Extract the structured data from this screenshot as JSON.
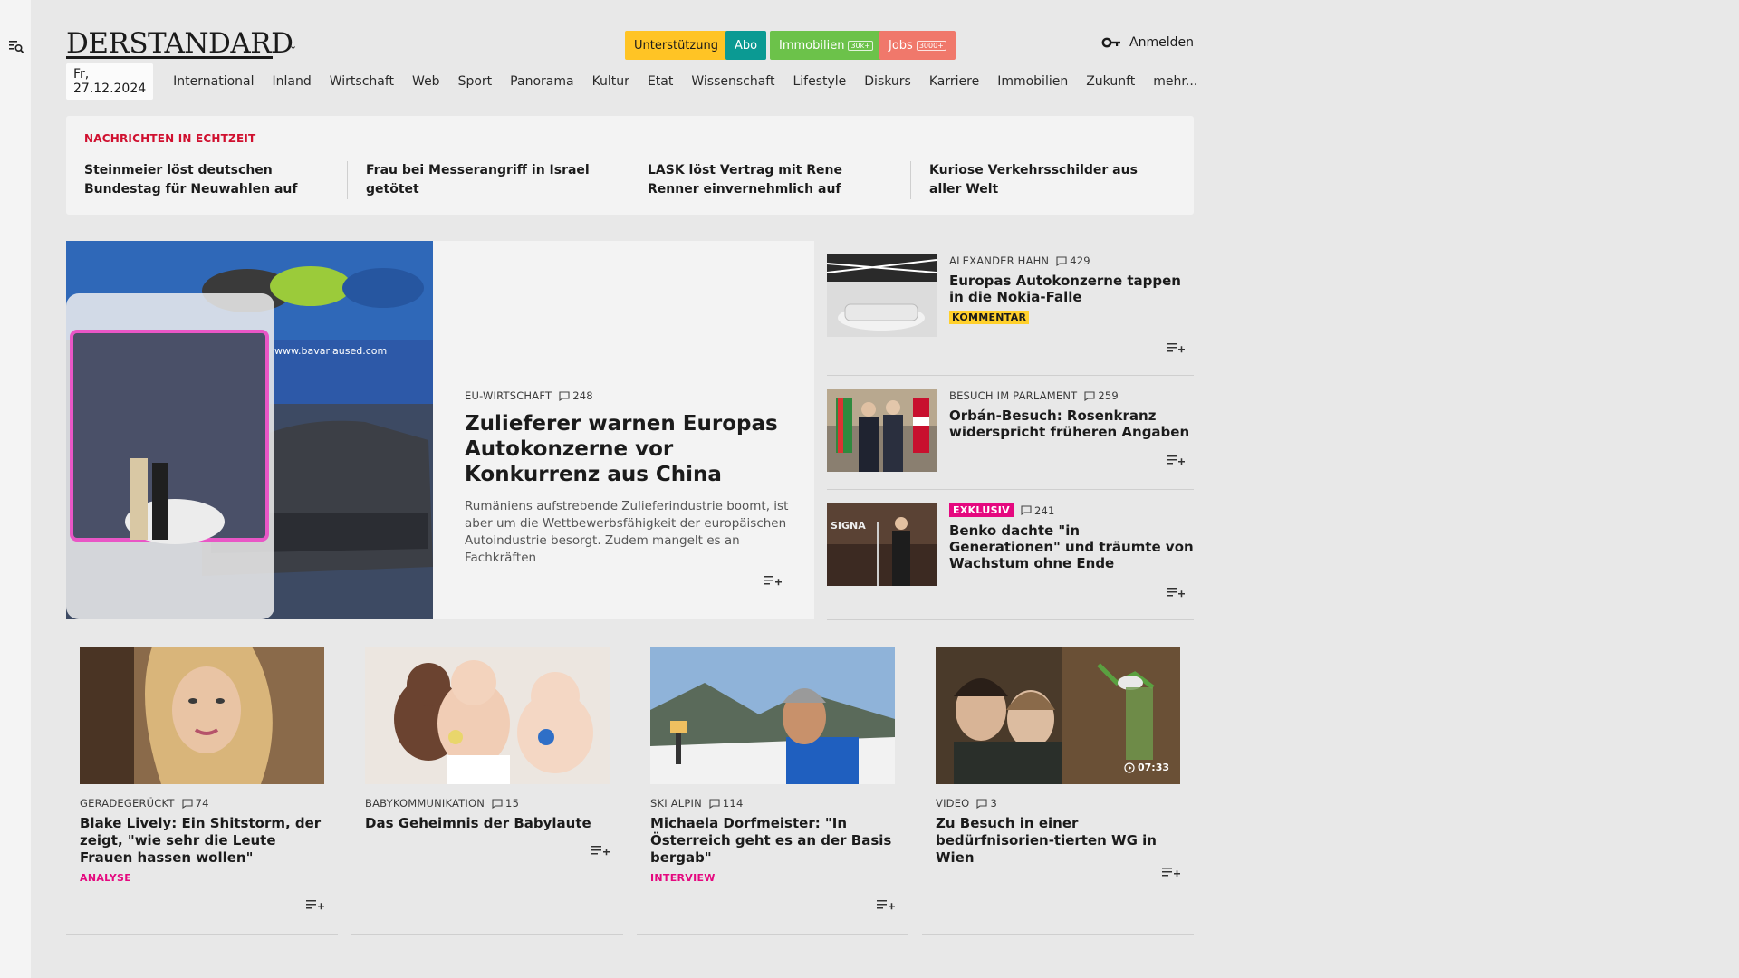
{
  "header": {
    "logo": "DERSTANDARD",
    "pills": [
      {
        "label": "Unterstützung",
        "badge": "",
        "bg": "#ffc425",
        "fg": "#1b1b1b"
      },
      {
        "label": "Abo",
        "badge": "",
        "bg": "#0b9a93",
        "fg": "#ffffff"
      },
      {
        "label": "Immobilien",
        "badge": "30k+",
        "bg": "#6cc24a",
        "fg": "#ffffff"
      },
      {
        "label": "Jobs",
        "badge": "3000+",
        "bg": "#f0786b",
        "fg": "#ffffff"
      }
    ],
    "login": "Anmelden",
    "date": "Fr, 27.12.2024",
    "nav": [
      "International",
      "Inland",
      "Wirtschaft",
      "Web",
      "Sport",
      "Panorama",
      "Kultur",
      "Etat",
      "Wissenschaft",
      "Lifestyle",
      "Diskurs",
      "Karriere",
      "Immobilien",
      "Zukunft",
      "mehr..."
    ]
  },
  "ticker": {
    "label": "NACHRICHTEN IN ECHTZEIT",
    "items": [
      "Steinmeier löst deutschen Bundestag für Neuwahlen auf",
      "Frau bei Messerangriff in Israel getötet",
      "LASK löst Vertrag mit Rene Renner einvernehmlich auf",
      "Kuriose Verkehrsschilder aus aller Welt"
    ]
  },
  "hero": {
    "kicker": "EU-WIRTSCHAFT",
    "comments": "248",
    "title": "Zulieferer warnen Europas Autokonzerne vor Konkurrenz aus China",
    "teaser": "Rumäniens aufstrebende Zulieferindustrie boomt, ist aber um die Wettbewerbsfähigkeit der europäischen Autoindustrie besorgt. Zudem mangelt es an Fachkräften",
    "image_text": "www.bavariaused.com"
  },
  "side": [
    {
      "kicker": "ALEXANDER HAHN",
      "comments": "429",
      "title": "Europas Autokonzerne tappen in die Nokia-Falle",
      "tag": "KOMMENTAR",
      "exclusive": ""
    },
    {
      "kicker": "BESUCH IM PARLAMENT",
      "comments": "259",
      "title": "Orbán-Besuch: Rosenkranz widerspricht früheren Angaben",
      "tag": "",
      "exclusive": ""
    },
    {
      "kicker": "",
      "comments": "241",
      "title": "Benko dachte \"in Generationen\" und träumte von Wachstum ohne Ende",
      "tag": "",
      "exclusive": "EXKLUSIV",
      "image_text": "SIGNA"
    }
  ],
  "cards": [
    {
      "kicker": "GERADEGERÜCKT",
      "comments": "74",
      "title": "Blake Lively: Ein Shitstorm, der zeigt, \"wie sehr die Leute Frauen hassen wollen\"",
      "sub": "ANALYSE",
      "duration": ""
    },
    {
      "kicker": "BABYKOMMUNIKATION",
      "comments": "15",
      "title": "Das Geheimnis der Babylaute",
      "sub": "",
      "duration": ""
    },
    {
      "kicker": "SKI ALPIN",
      "comments": "114",
      "title": "Michaela Dorfmeister: \"In Österreich geht es an der Basis bergab\"",
      "sub": "INTERVIEW",
      "duration": ""
    },
    {
      "kicker": "VIDEO",
      "comments": "3",
      "title": "Zu Besuch in einer bedürfnisorien-tierten WG in Wien",
      "sub": "",
      "duration": "07:33"
    }
  ]
}
